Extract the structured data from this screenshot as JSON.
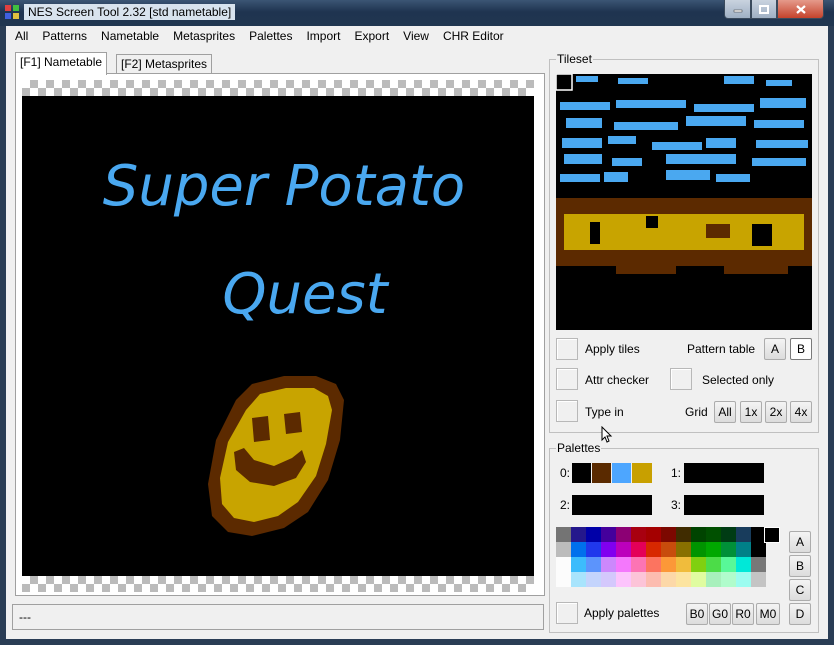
{
  "window": {
    "title": "NES Screen Tool 2.32  [std nametable]"
  },
  "menu": [
    "All",
    "Patterns",
    "Nametable",
    "Metasprites",
    "Palettes",
    "Import",
    "Export",
    "View",
    "CHR Editor"
  ],
  "tabs": [
    "[F1] Nametable",
    "[F2] Metasprites"
  ],
  "nametable": {
    "title_line1": "Super Potato",
    "title_line2": "Quest"
  },
  "status": "---",
  "tileset": {
    "group_title": "Tileset",
    "apply_tiles": "Apply tiles",
    "pattern_table_label": "Pattern table",
    "pattern_a": "A",
    "pattern_b": "B",
    "attr_checker": "Attr checker",
    "selected_only": "Selected only",
    "type_in": "Type in",
    "grid_label": "Grid",
    "grid_all": "All",
    "grid_1x": "1x",
    "grid_2x": "2x",
    "grid_4x": "4x"
  },
  "palettes": {
    "group_title": "Palettes",
    "labels": [
      "0:",
      "1:",
      "2:",
      "3:"
    ],
    "pal0": [
      "#000000",
      "#5a2a00",
      "#4da6ff",
      "#c8a000"
    ],
    "pal1": [
      "#000000",
      "#000000",
      "#000000",
      "#000000"
    ],
    "pal2": [
      "#000000",
      "#000000",
      "#000000",
      "#000000"
    ],
    "pal3": [
      "#000000",
      "#000000",
      "#000000",
      "#000000"
    ],
    "side_buttons": [
      "A",
      "B",
      "C",
      "D"
    ],
    "apply_palettes": "Apply palettes",
    "bottom_buttons": [
      "B0",
      "G0",
      "R0",
      "M0"
    ],
    "nes_rows": [
      [
        "#747474",
        "#24188c",
        "#0000a8",
        "#44009c",
        "#8c0074",
        "#a80010",
        "#a40000",
        "#7c0800",
        "#402c00",
        "#004400",
        "#005000",
        "#003c14",
        "#183c5c",
        "#000000"
      ],
      [
        "#bcbcbc",
        "#0070ec",
        "#2038ec",
        "#8000f0",
        "#bc00bc",
        "#e40058",
        "#d82800",
        "#c84c0c",
        "#887000",
        "#009400",
        "#00a800",
        "#009038",
        "#008088",
        "#000000"
      ],
      [
        "#fcfcfc",
        "#3cbcfc",
        "#5c94fc",
        "#cc88fc",
        "#f478fc",
        "#fc74b4",
        "#fc7460",
        "#fc9838",
        "#f0bc3c",
        "#80d010",
        "#4cdc48",
        "#58f898",
        "#00e8d8",
        "#787878"
      ],
      [
        "#fcfcfc",
        "#a8e4fc",
        "#c4d4fc",
        "#d4c8fc",
        "#fcc4fc",
        "#fcc4d8",
        "#fcbcb0",
        "#fcd8a8",
        "#fce4a0",
        "#e0fca0",
        "#a8f0bc",
        "#b0fccc",
        "#9cfcf0",
        "#c4c4c4"
      ]
    ]
  }
}
